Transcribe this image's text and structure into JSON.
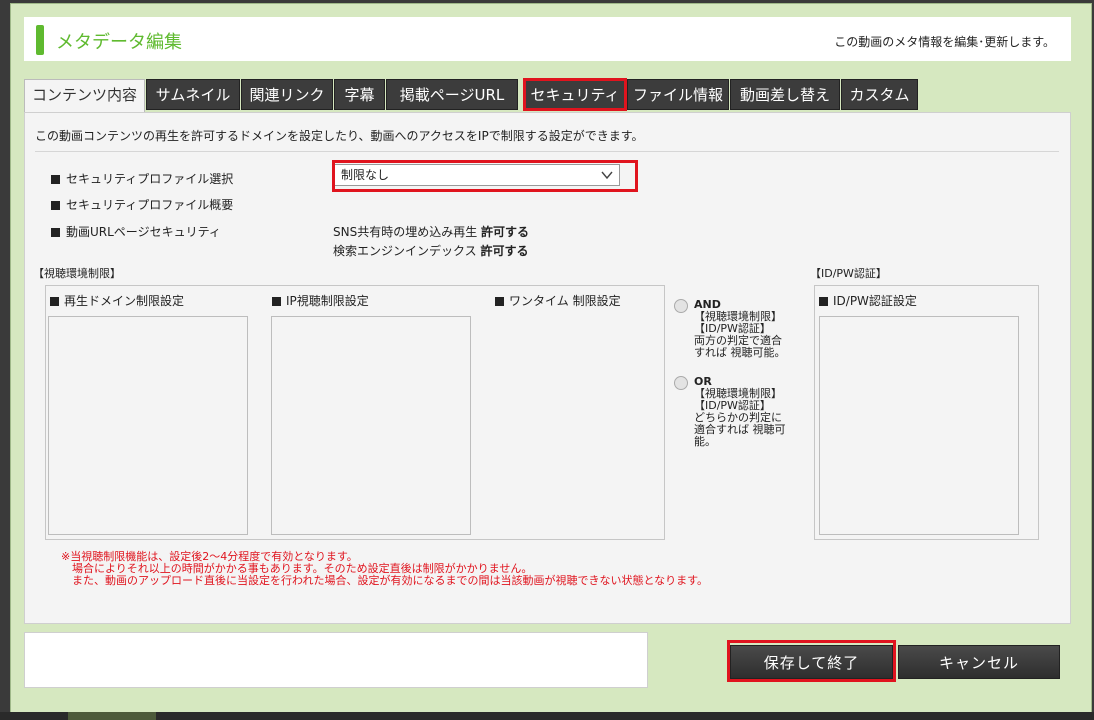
{
  "header": {
    "title": "メタデータ編集",
    "description": "この動画のメタ情報を編集･更新します。"
  },
  "tabs": [
    {
      "label": "コンテンツ内容",
      "active": true
    },
    {
      "label": "サムネイル"
    },
    {
      "label": "関連リンク"
    },
    {
      "label": "字幕"
    },
    {
      "label": "掲載ページURL"
    },
    {
      "label": "セキュリティ",
      "highlighted": true
    },
    {
      "label": "ファイル情報"
    },
    {
      "label": "動画差し替え"
    },
    {
      "label": "カスタム"
    }
  ],
  "intro": "この動画コンテンツの再生を許可するドメインを設定したり、動画へのアクセスをIPで制限する設定ができます。",
  "settings": {
    "profile_select_label": "セキュリティプロファイル選択",
    "profile_select_value": "制限なし",
    "profile_summary_label": "セキュリティプロファイル概要",
    "url_page_label": "動画URLページセキュリティ",
    "sns_text": "SNS共有時の埋め込み再生",
    "sns_value": "許可する",
    "search_text": "検索エンジンインデックス",
    "search_value": "許可する"
  },
  "viewing": {
    "title": "【視聴環境制限】",
    "domain_label": "再生ドメイン制限設定",
    "ip_label": "IP視聴制限設定",
    "onetime_label": "ワンタイム 制限設定"
  },
  "logic": {
    "and": {
      "head": "AND",
      "lines": [
        "【視聴環境制限】",
        "【ID/PW認証】",
        "両方の判定で適合",
        "すれば 視聴可能。"
      ]
    },
    "or": {
      "head": "OR",
      "lines": [
        "【視聴環境制限】",
        "【ID/PW認証】",
        "どちらかの判定に",
        "適合すれば 視聴可",
        "能。"
      ]
    }
  },
  "idpw": {
    "title": "【ID/PW認証】",
    "label": "ID/PW認証設定"
  },
  "notes": [
    "※当視聴制限機能は、設定後2～4分程度で有効となります。",
    "　場合によりそれ以上の時間がかかる事もあります。そのため設定直後は制限がかかりません。",
    "　また、動画のアップロード直後に当設定を行われた場合、設定が有効になるまでの間は当該動画が視聴できない状態となります。"
  ],
  "buttons": {
    "save": "保存して終了",
    "cancel": "キャンセル"
  },
  "colors": {
    "accent": "#5fba2f",
    "highlight": "#e0141e",
    "modal_bg": "#d6e8c0",
    "tab_bg": "#3c3c3c"
  }
}
